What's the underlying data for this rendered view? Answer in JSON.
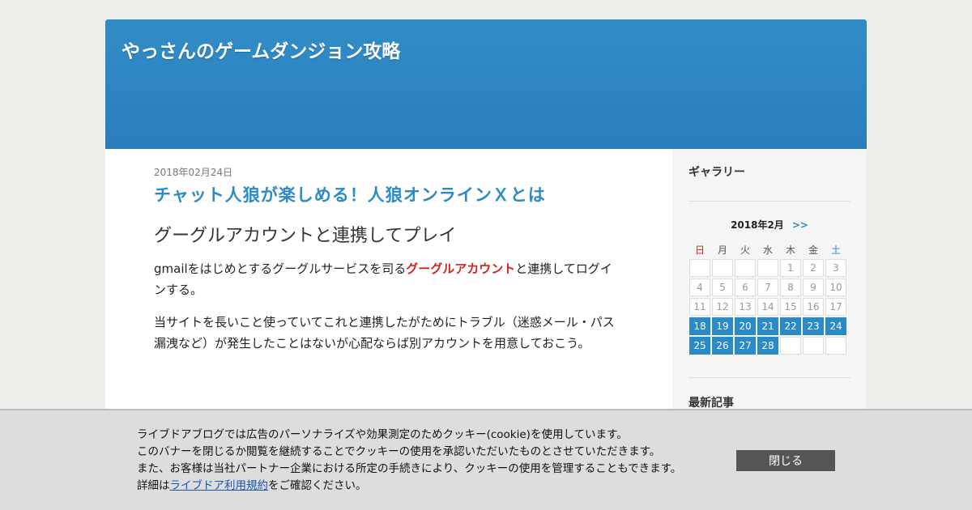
{
  "header": {
    "title": "やっさんのゲームダンジョン攻略"
  },
  "post": {
    "date": "2018年02月24日",
    "title": "チャット人狼が楽しめる！人狼オンラインＸとは",
    "heading": "グーグルアカウントと連携してプレイ",
    "p1_before": "gmailをはじめとするグーグルサービスを司る",
    "p1_link": "グーグルアカウント",
    "p1_after": "と連携してログインする。",
    "p2": "当サイトを長いこと使っていてこれと連携したがためにトラブル（迷惑メール・パス漏洩など）が発生したことはないが心配ならば別アカウントを用意しておこう。"
  },
  "sidebar": {
    "gallery_heading": "ギャラリー",
    "calendar_month": "2018年2月",
    "calendar_next": ">>",
    "weekdays": [
      "日",
      "月",
      "火",
      "水",
      "木",
      "金",
      "土"
    ],
    "weeks": [
      [
        "",
        "",
        "",
        "",
        "1",
        "2",
        "3"
      ],
      [
        "4",
        "5",
        "6",
        "7",
        "8",
        "9",
        "10"
      ],
      [
        "11",
        "12",
        "13",
        "14",
        "15",
        "16",
        "17"
      ],
      [
        "18",
        "19",
        "20",
        "21",
        "22",
        "23",
        "24"
      ],
      [
        "25",
        "26",
        "27",
        "28",
        "",
        "",
        ""
      ]
    ],
    "highlight_from": 18,
    "recent_heading": "最新記事"
  },
  "cookie": {
    "line1": "ライブドアブログでは広告のパーソナライズや効果測定のためクッキー(cookie)を使用しています。",
    "line2": "このバナーを閉じるか閲覧を継続することでクッキーの使用を承認いただいたものとさせていただきます。",
    "line3": "また、お客様は当社パートナー企業における所定の手続きにより、クッキーの使用を管理することもできます。",
    "line4_before": "詳細は",
    "line4_link": "ライブドア利用規約",
    "line4_after": "をご確認ください。",
    "close_label": "閉じる"
  },
  "colors": {
    "header_blue": "#2a8bc6",
    "link_red": "#d3221b",
    "page_bg": "#eeeeea"
  }
}
